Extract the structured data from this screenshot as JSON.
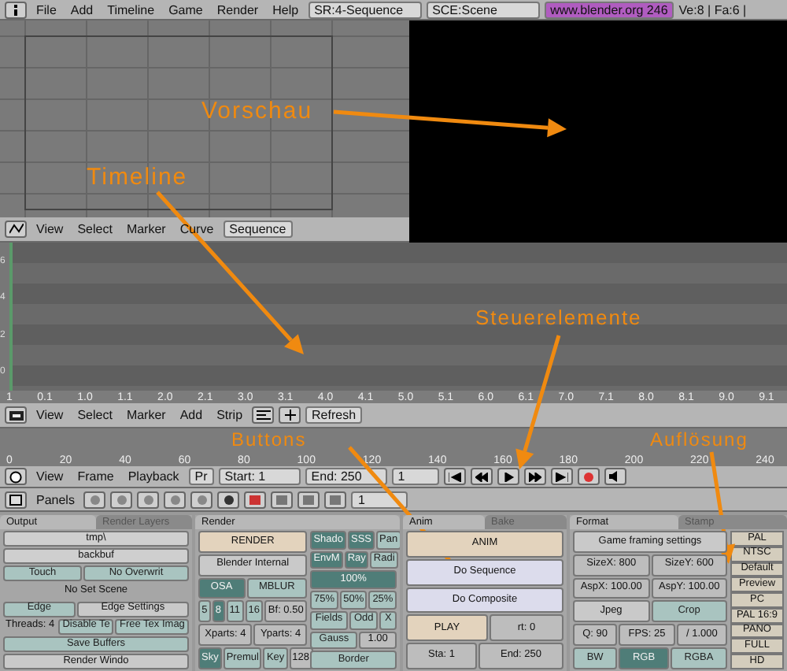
{
  "menu_bar": {
    "menus": [
      "File",
      "Add",
      "Timeline",
      "Game",
      "Render",
      "Help"
    ],
    "screen": "SR:4-Sequence",
    "scene": "SCE:Scene",
    "url": "www.blender.org 246",
    "stats": "Ve:8 | Fa:6 |"
  },
  "preview_header": {
    "menus": [
      "View",
      "Select",
      "Marker",
      "Curve"
    ],
    "mode": "Sequence"
  },
  "sequencer": {
    "channels": [
      "6",
      "4",
      "2",
      "0"
    ],
    "ruler": [
      "1",
      "0.1",
      "1.0",
      "1.1",
      "2.0",
      "2.1",
      "3.0",
      "3.1",
      "4.0",
      "4.1",
      "5.0",
      "5.1",
      "6.0",
      "6.1",
      "7.0",
      "7.1",
      "8.0",
      "8.1",
      "9.0",
      "9.1"
    ]
  },
  "sequencer_header": {
    "menus": [
      "View",
      "Select",
      "Marker",
      "Add",
      "Strip"
    ],
    "refresh": "Refresh"
  },
  "timeline": {
    "ruler": [
      "0",
      "20",
      "40",
      "60",
      "80",
      "100",
      "120",
      "140",
      "160",
      "180",
      "200",
      "220",
      "240"
    ]
  },
  "timeline_header": {
    "menus": [
      "View",
      "Frame",
      "Playback"
    ],
    "preview": "Pr",
    "start": "Start: 1",
    "end": "End: 250",
    "frame": "1"
  },
  "buttons_header": {
    "label": "Panels",
    "page": "1"
  },
  "panels": [
    {
      "tabs": [
        {
          "label": "Output",
          "selected": true
        },
        {
          "label": "Render Layers",
          "selected": false
        }
      ],
      "rows": [
        [
          {
            "kind": "text",
            "text": "tmp\\"
          }
        ],
        [
          {
            "kind": "text",
            "text": "backbuf"
          }
        ],
        [
          {
            "kind": "toggle",
            "text": "Touch",
            "on": false
          },
          {
            "kind": "toggle",
            "text": "No Overwrit",
            "on": false
          }
        ],
        [
          {
            "kind": "label",
            "text": "No Set Scene"
          }
        ],
        [
          {
            "kind": "toggle",
            "text": "Edge",
            "on": false
          },
          {
            "kind": "menu",
            "text": "Edge Settings"
          }
        ],
        [
          {
            "kind": "label",
            "text": "Threads: 4"
          },
          {
            "kind": "toggle",
            "text": "Disable Te",
            "on": false
          },
          {
            "kind": "toggle",
            "text": "Free Tex Imag",
            "on": false
          }
        ],
        [
          {
            "kind": "toggle",
            "text": "Save Buffers",
            "on": false
          }
        ],
        [
          {
            "kind": "menu",
            "text": "Render Windo"
          }
        ]
      ]
    },
    {
      "tabs": [
        {
          "label": "Render",
          "selected": true
        }
      ],
      "rows": [
        [
          {
            "kind": "action",
            "text": "RENDER"
          }
        ],
        [
          {
            "kind": "menu",
            "text": "Blender Internal"
          }
        ],
        [
          {
            "kind": "toggle",
            "text": "OSA",
            "on": true
          },
          {
            "kind": "toggle",
            "text": "MBLUR",
            "on": false
          }
        ],
        [
          {
            "kind": "choice",
            "options": [
              {
                "text": "5",
                "selected": false
              },
              {
                "text": "8",
                "selected": true
              },
              {
                "text": "11",
                "selected": false
              },
              {
                "text": "16",
                "selected": false
              }
            ]
          },
          {
            "kind": "number",
            "text": "Bf: 0.50"
          }
        ],
        [
          {
            "kind": "number",
            "text": "Xparts: 4"
          },
          {
            "kind": "number",
            "text": "Yparts: 4"
          }
        ],
        [
          {
            "kind": "choice",
            "options": [
              {
                "text": "Sky",
                "selected": true
              },
              {
                "text": "Premul",
                "selected": false
              },
              {
                "text": "Key",
                "selected": false
              }
            ]
          },
          {
            "kind": "number",
            "text": "128"
          }
        ]
      ],
      "side_rows": [
        [
          {
            "kind": "toggle",
            "text": "Shado",
            "on": true
          },
          {
            "kind": "toggle",
            "text": "SSS",
            "on": true
          },
          {
            "kind": "toggle",
            "text": "Pan",
            "on": false
          }
        ],
        [
          {
            "kind": "toggle",
            "text": "EnvM",
            "on": true
          },
          {
            "kind": "toggle",
            "text": "Ray",
            "on": true
          },
          {
            "kind": "toggle",
            "text": "Radi",
            "on": false
          }
        ],
        [
          {
            "kind": "toggle",
            "text": "100%",
            "on": true
          }
        ],
        [
          {
            "kind": "toggle",
            "text": "75%",
            "on": false
          },
          {
            "kind": "toggle",
            "text": "50%",
            "on": false
          },
          {
            "kind": "toggle",
            "text": "25%",
            "on": false
          }
        ],
        [
          {
            "kind": "toggle",
            "text": "Fields",
            "on": false
          },
          {
            "kind": "toggle",
            "text": "Odd",
            "on": false
          },
          {
            "kind": "toggle",
            "text": "X",
            "on": false
          }
        ],
        [
          {
            "kind": "toggle",
            "text": "Gauss",
            "on": false
          },
          {
            "kind": "number",
            "text": "1.00"
          }
        ],
        [
          {
            "kind": "toggle",
            "text": "Border",
            "on": false
          }
        ]
      ]
    },
    {
      "tabs": [
        {
          "label": "Anim",
          "selected": true
        },
        {
          "label": "Bake",
          "selected": false
        }
      ],
      "rows": [
        [
          {
            "kind": "action",
            "text": "ANIM"
          }
        ],
        [
          {
            "kind": "option",
            "text": "Do Sequence"
          }
        ],
        [
          {
            "kind": "option",
            "text": "Do Composite"
          }
        ],
        [
          {
            "kind": "action",
            "text": "PLAY"
          },
          {
            "kind": "number",
            "text": "rt: 0"
          }
        ],
        [
          {
            "kind": "number",
            "text": "Sta: 1"
          },
          {
            "kind": "number",
            "text": "End: 250"
          }
        ]
      ]
    },
    {
      "tabs": [
        {
          "label": "Format",
          "selected": true
        },
        {
          "label": "Stamp",
          "selected": false
        }
      ],
      "rows": [
        [
          {
            "kind": "menu",
            "text": "Game framing settings"
          }
        ],
        [
          {
            "kind": "number",
            "text": "SizeX: 800"
          },
          {
            "kind": "number",
            "text": "SizeY: 600"
          }
        ],
        [
          {
            "kind": "number",
            "text": "AspX: 100.00"
          },
          {
            "kind": "number",
            "text": "AspY: 100.00"
          }
        ],
        [
          {
            "kind": "menu",
            "text": "Jpeg"
          },
          {
            "kind": "toggle",
            "text": "Crop",
            "on": false
          }
        ],
        [
          {
            "kind": "number",
            "text": "Q: 90"
          },
          {
            "kind": "number",
            "text": "FPS: 25"
          },
          {
            "kind": "number",
            "text": "/ 1.000"
          }
        ],
        [
          {
            "kind": "toggle",
            "text": "BW",
            "on": false
          },
          {
            "kind": "toggle",
            "text": "RGB",
            "on": true
          },
          {
            "kind": "toggle",
            "text": "RGBA",
            "on": false
          }
        ]
      ],
      "presets": [
        "PAL",
        "NTSC",
        "Default",
        "Preview",
        "PC",
        "PAL 16:9",
        "PANO",
        "FULL",
        "HD"
      ]
    }
  ],
  "annotations": [
    "Vorschau",
    "Timeline",
    "Steuerelemente",
    "Buttons",
    "Auflösung"
  ]
}
